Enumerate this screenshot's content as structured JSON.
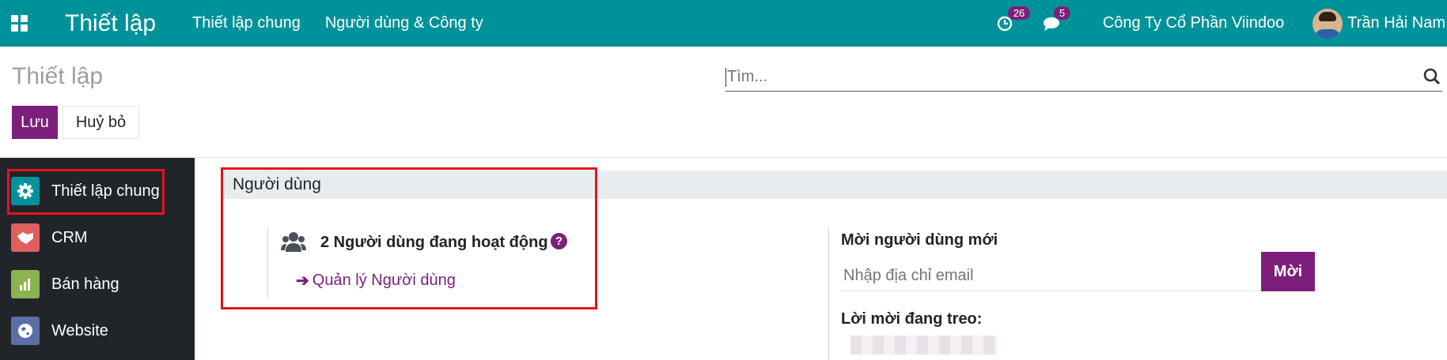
{
  "navbar": {
    "app_title": "Thiết lập",
    "menu": [
      "Thiết lập chung",
      "Người dùng & Công ty"
    ],
    "activity_count": "26",
    "message_count": "5",
    "company": "Công Ty Cổ Phần Viindoo",
    "user_name": "Trần Hải Nam",
    "bg_color": "#00929a"
  },
  "control_panel": {
    "title": "Thiết lập",
    "search_placeholder": "Tìm...",
    "save_label": "Lưu",
    "discard_label": "Huỷ bỏ"
  },
  "sidebar": {
    "items": [
      {
        "label": "Thiết lập chung",
        "icon": "gear-icon",
        "color": "#00929a"
      },
      {
        "label": "CRM",
        "icon": "handshake-icon",
        "color": "#e06060"
      },
      {
        "label": "Bán hàng",
        "icon": "chart-icon",
        "color": "#8bb352"
      },
      {
        "label": "Website",
        "icon": "globe-icon",
        "color": "#5b6ea6"
      }
    ]
  },
  "users_section": {
    "title": "Người dùng",
    "active_users": "2 Người dùng đang hoạt động",
    "manage_link": "Quản lý Người dùng",
    "invite_label": "Mời người dùng mới",
    "email_placeholder": "Nhập địa chỉ email",
    "invite_button": "Mời",
    "pending_label": "Lời mời đang treo:"
  },
  "colors": {
    "primary": "#7c1f7a",
    "highlight": "#e4141d"
  }
}
